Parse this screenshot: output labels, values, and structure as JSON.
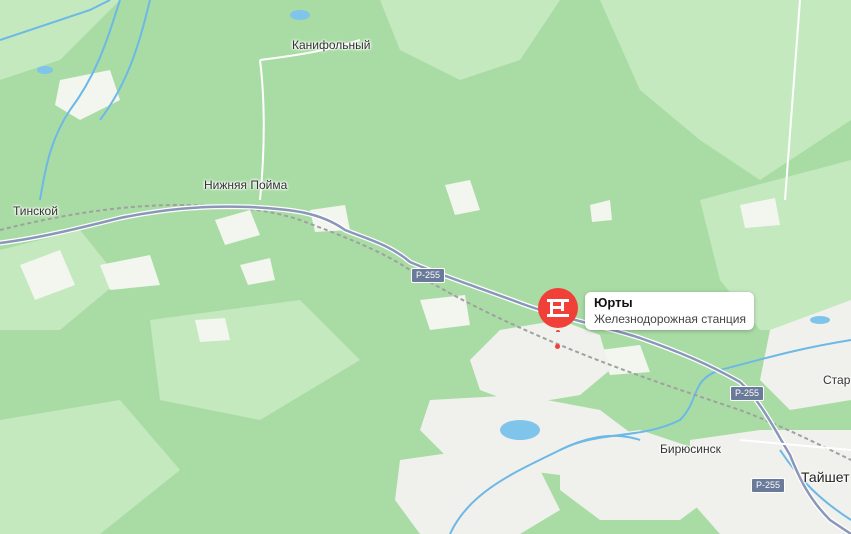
{
  "map": {
    "places": [
      {
        "id": "kanifolny",
        "name": "Канифольный"
      },
      {
        "id": "nizhnyaya",
        "name": "Нижняя Пойма"
      },
      {
        "id": "tinskoy",
        "name": "Тинской"
      },
      {
        "id": "biryusinsk",
        "name": "Бирюсинск"
      },
      {
        "id": "taishet",
        "name": "Тайшет"
      },
      {
        "id": "stary",
        "name": "Стар"
      }
    ],
    "road_shields": [
      "Р-255",
      "Р-255",
      "Р-255"
    ],
    "selected": {
      "name": "Юрты",
      "type": "Железнодорожная станция",
      "icon": "train-station-icon"
    },
    "colors": {
      "forest": "#a9dca5",
      "forest_light": "#c2e8bd",
      "urban": "#f0f0ec",
      "water": "#7fc4ea",
      "road": "#8a97b8",
      "rail": "#9a9a9a",
      "pin": "#f04038"
    }
  }
}
